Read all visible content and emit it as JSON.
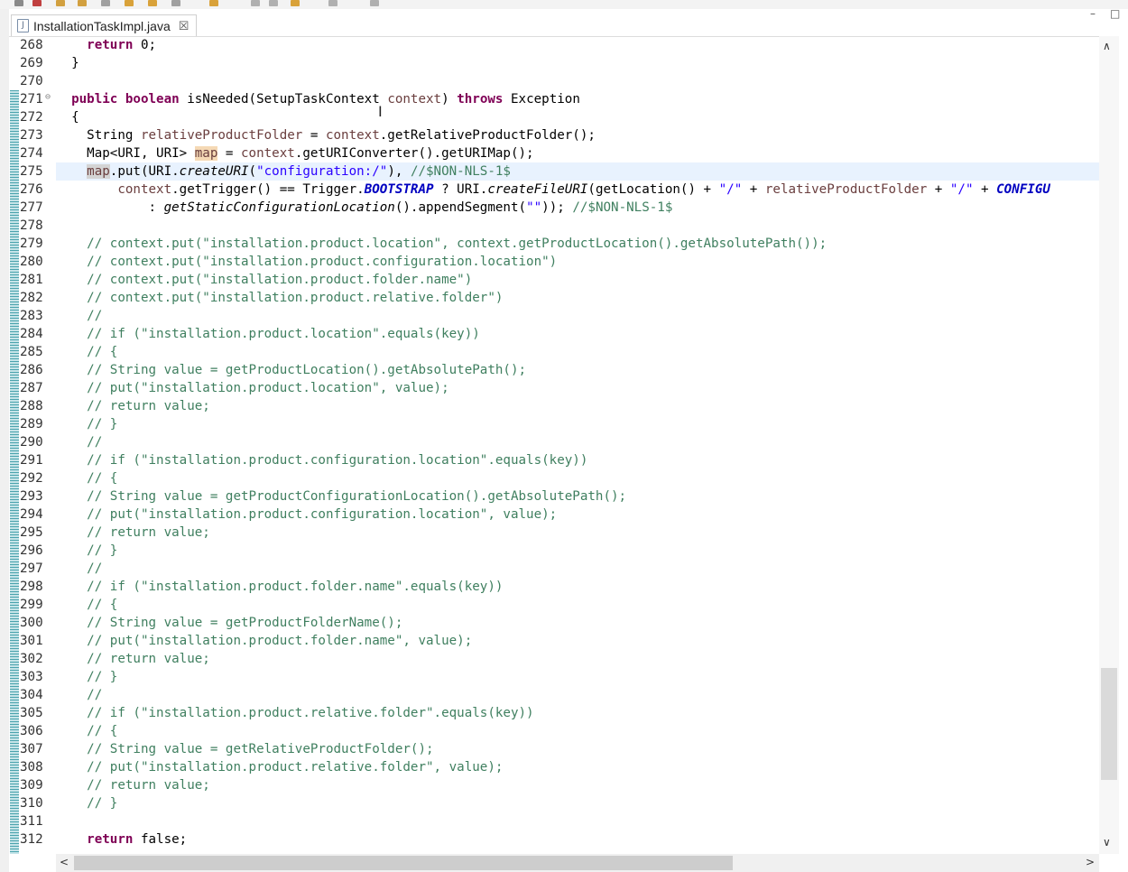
{
  "tab": {
    "title": "InstallationTaskImpl.java",
    "icon": "java-file-icon",
    "close": "☒"
  },
  "window": {
    "minimize": "–",
    "maximize": "□"
  },
  "scroll": {
    "up": "∧",
    "down": "∨",
    "left": "<",
    "right": ">"
  },
  "line_numbers": [
    "268",
    "269",
    "270",
    "271",
    "272",
    "273",
    "274",
    "275",
    "276",
    "277",
    "278",
    "279",
    "280",
    "281",
    "282",
    "283",
    "284",
    "285",
    "286",
    "287",
    "288",
    "289",
    "290",
    "291",
    "292",
    "293",
    "294",
    "295",
    "296",
    "297",
    "298",
    "299",
    "300",
    "301",
    "302",
    "303",
    "304",
    "305",
    "306",
    "307",
    "308",
    "309",
    "310",
    "311",
    "312"
  ],
  "code": {
    "l268_kw": "return",
    "l268_rest": " 0;",
    "l269": "}",
    "l271_kw1": "public",
    "l271_kw2": "boolean",
    "l271_a": " isNeeded(SetupTaskContext ",
    "l271_v": "context",
    "l271_b": ") ",
    "l271_kw3": "throws",
    "l271_c": " Exception",
    "l272": "{",
    "l273_a": "String ",
    "l273_v": "relativeProductFolder",
    "l273_b": " = ",
    "l273_v2": "context",
    "l273_c": ".getRelativeProductFolder();",
    "l274_a": "Map<URI, URI> ",
    "l274_v": "map",
    "l274_b": " = ",
    "l274_v2": "context",
    "l274_c": ".getURIConverter().getURIMap();",
    "l275_v": "map",
    "l275_a": ".put(URI.",
    "l275_i": "createURI",
    "l275_b": "(",
    "l275_s": "\"configuration:/\"",
    "l275_c": "), ",
    "l275_cm": "//$NON-NLS-1$",
    "l276_v": "context",
    "l276_a": ".getTrigger() == Trigger.",
    "l276_f": "BOOTSTRAP",
    "l276_b": " ? URI.",
    "l276_i": "createFileURI",
    "l276_c": "(getLocation() + ",
    "l276_s1": "\"/\"",
    "l276_d": " + ",
    "l276_v2": "relativeProductFolder",
    "l276_e": " + ",
    "l276_s2": "\"/\"",
    "l276_f2": " + ",
    "l276_g": "CONFIGU",
    "l277_a": ": ",
    "l277_i": "getStaticConfigurationLocation",
    "l277_b": "().appendSegment(",
    "l277_s": "\"\"",
    "l277_c": ")); ",
    "l277_cm": "//$NON-NLS-1$",
    "l279": "// context.put(\"installation.product.location\", context.getProductLocation().getAbsolutePath());",
    "l280": "// context.put(\"installation.product.configuration.location\")",
    "l281": "// context.put(\"installation.product.folder.name\")",
    "l282": "// context.put(\"installation.product.relative.folder\")",
    "l283": "//",
    "l284": "// if (\"installation.product.location\".equals(key))",
    "l285": "// {",
    "l286": "// String value = getProductLocation().getAbsolutePath();",
    "l287": "// put(\"installation.product.location\", value);",
    "l288": "// return value;",
    "l289": "// }",
    "l290": "//",
    "l291": "// if (\"installation.product.configuration.location\".equals(key))",
    "l292": "// {",
    "l293": "// String value = getProductConfigurationLocation().getAbsolutePath();",
    "l294": "// put(\"installation.product.configuration.location\", value);",
    "l295": "// return value;",
    "l296": "// }",
    "l297": "//",
    "l298": "// if (\"installation.product.folder.name\".equals(key))",
    "l299": "// {",
    "l300": "// String value = getProductFolderName();",
    "l301": "// put(\"installation.product.folder.name\", value);",
    "l302": "// return value;",
    "l303": "// }",
    "l304": "//",
    "l305": "// if (\"installation.product.relative.folder\".equals(key))",
    "l306": "// {",
    "l307": "// String value = getRelativeProductFolder();",
    "l308": "// put(\"installation.product.relative.folder\", value);",
    "l309": "// return value;",
    "l310": "// }",
    "l312_kw": "return",
    "l312_rest": " false;"
  }
}
